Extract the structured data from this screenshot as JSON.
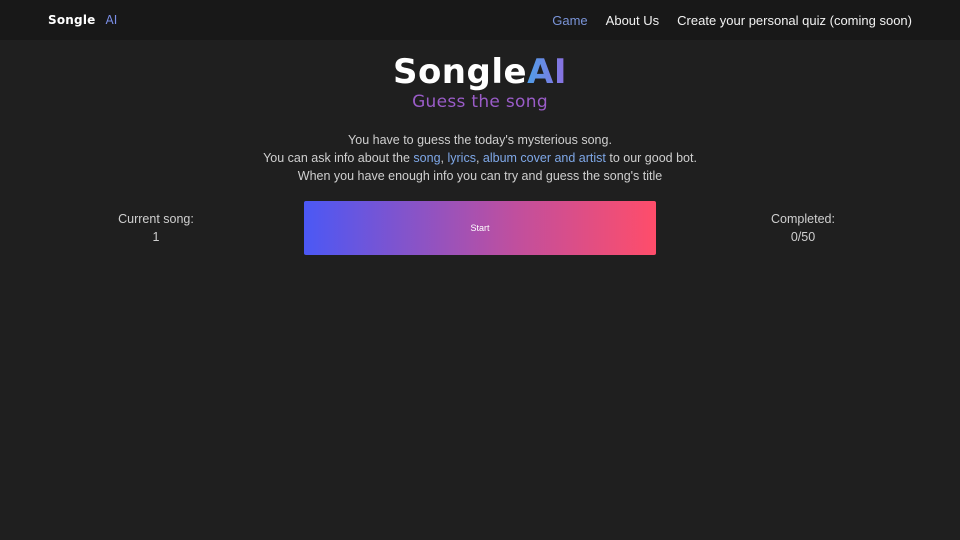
{
  "navbar": {
    "brand_word": "Songle",
    "brand_ai": "AI",
    "links": [
      {
        "label": "Game"
      },
      {
        "label": "About Us"
      },
      {
        "label": "Create your personal quiz (coming soon)"
      }
    ],
    "active_color": "#7a94d8"
  },
  "hero": {
    "logo_word": "Songle",
    "logo_ai": "AI",
    "tagline": "Guess the song"
  },
  "intro": {
    "line1": "You have to guess the today's mysterious song.",
    "line2_before": "You can ask info about the ",
    "line2_song": "song",
    "line2_sep1": ", ",
    "line2_lyrics": "lyrics",
    "line2_sep2": ", ",
    "line2_album": "album cover and artist",
    "line2_after": " to our good bot.",
    "line3": "When you have enough info you can try and guess the song's title"
  },
  "stats": {
    "current_label": "Current song:",
    "current_value": "1",
    "completed_label": "Completed:",
    "completed_value": "0/50"
  },
  "start_button": {
    "label": "Start"
  },
  "colors": {
    "background": "#1f1f1f",
    "navbar": "#181818",
    "highlight": "#7fa8e8",
    "tagline": "#9a5cc8",
    "button_gradient_start": "#4b58f5",
    "button_gradient_end": "#ff4d6a"
  }
}
